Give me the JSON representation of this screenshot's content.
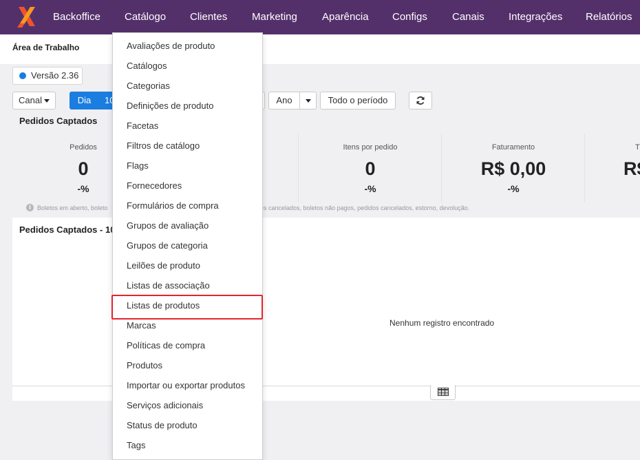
{
  "nav": {
    "brand_color": "#54306b",
    "items": [
      {
        "label": "Backoffice"
      },
      {
        "label": "Catálogo"
      },
      {
        "label": "Clientes"
      },
      {
        "label": "Marketing"
      },
      {
        "label": "Aparência"
      },
      {
        "label": "Configs"
      },
      {
        "label": "Canais"
      },
      {
        "label": "Integrações"
      },
      {
        "label": "Relatórios"
      }
    ]
  },
  "workspace": {
    "title": "Área de Trabalho"
  },
  "version": {
    "label": "Versão 2.36",
    "dot_color": "#1b7de0"
  },
  "filters": {
    "canal": "Canal",
    "dia": "Dia",
    "dia_next": "10",
    "ano": "Ano",
    "todo": "Todo o período",
    "refresh_icon": "refresh-icon"
  },
  "summary": {
    "title": "Pedidos Captados",
    "stats": [
      {
        "label": "Pedidos",
        "value": "0",
        "delta": "-%"
      },
      {
        "label": "Itens por pedido",
        "value": "0",
        "delta": "-%"
      },
      {
        "label": "Faturamento",
        "value": "R$ 0,00",
        "delta": "-%"
      },
      {
        "label": "T",
        "value": "R$"
      }
    ],
    "note_left": "Boletos em aberto, boleto",
    "note_right": "es cancelados, boletos não pagos, pedidos cancelados, estorno, devolução."
  },
  "panel": {
    "title": "Pedidos Captados - 10",
    "empty": "Nenhum registro encontrado",
    "grid_icon": "table-icon"
  },
  "dropdown": {
    "highlight_color": "#e3242b",
    "items": [
      {
        "label": "Avaliações de produto"
      },
      {
        "label": "Catálogos"
      },
      {
        "label": "Categorias"
      },
      {
        "label": "Definições de produto"
      },
      {
        "label": "Facetas"
      },
      {
        "label": "Filtros de catálogo"
      },
      {
        "label": "Flags"
      },
      {
        "label": "Fornecedores"
      },
      {
        "label": "Formulários de compra"
      },
      {
        "label": "Grupos de avaliação"
      },
      {
        "label": "Grupos de categoria"
      },
      {
        "label": "Leilões de produto"
      },
      {
        "label": "Listas de associação"
      },
      {
        "label": "Listas de produtos"
      },
      {
        "label": "Marcas"
      },
      {
        "label": "Políticas de compra"
      },
      {
        "label": "Produtos"
      },
      {
        "label": "Importar ou exportar produtos"
      },
      {
        "label": "Serviços adicionais"
      },
      {
        "label": "Status de produto"
      },
      {
        "label": "Tags"
      }
    ]
  }
}
